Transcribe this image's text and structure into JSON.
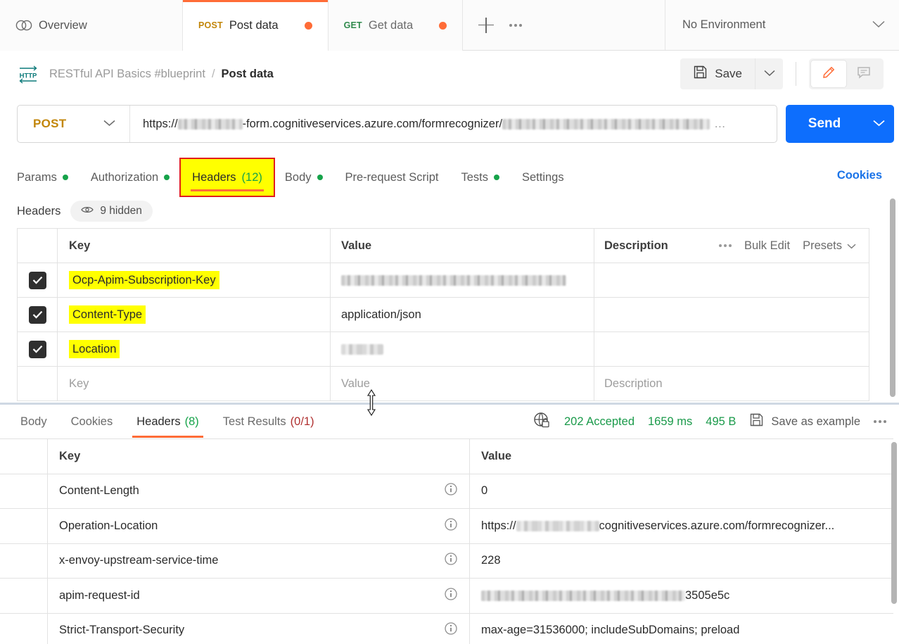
{
  "tabbar": {
    "overview_label": "Overview",
    "tabs": [
      {
        "method": "POST",
        "name": "Post data",
        "unsaved": true,
        "active": true
      },
      {
        "method": "GET",
        "name": "Get data",
        "unsaved": true,
        "active": false
      }
    ],
    "new_tab_label": "+",
    "more_label": "•••",
    "environment": "No Environment"
  },
  "breadcrumb": {
    "icon": "http-icon",
    "collection": "RESTful API Basics #blueprint",
    "separator": "/",
    "current": "Post data",
    "save_label": "Save",
    "save_caret": "chevron-down-icon",
    "edit_icon": "pencil-icon",
    "comment_icon": "comment-icon"
  },
  "url": {
    "method": "POST",
    "value_prefix": "https://",
    "value_mid": "-form.cognitiveservices.azure.com/formrecognizer/",
    "value_ellipsis": "…",
    "send_label": "Send"
  },
  "request_tabs": [
    {
      "label": "Params",
      "dot": true,
      "count": "",
      "active": false,
      "highlight": false
    },
    {
      "label": "Authorization",
      "dot": true,
      "count": "",
      "active": false,
      "highlight": false
    },
    {
      "label": "Headers",
      "dot": false,
      "count": "(12)",
      "active": true,
      "highlight": true
    },
    {
      "label": "Body",
      "dot": true,
      "count": "",
      "active": false,
      "highlight": false
    },
    {
      "label": "Pre-request Script",
      "dot": false,
      "count": "",
      "active": false,
      "highlight": false
    },
    {
      "label": "Tests",
      "dot": true,
      "count": "",
      "active": false,
      "highlight": false
    },
    {
      "label": "Settings",
      "dot": false,
      "count": "",
      "active": false,
      "highlight": false
    }
  ],
  "cookies_link": "Cookies",
  "headers_section": {
    "title": "Headers",
    "hidden_label": "9 hidden",
    "eye_icon": "eye-icon",
    "columns": {
      "key": "Key",
      "value": "Value",
      "description": "Description"
    },
    "toolbar": {
      "more": "•••",
      "bulk_edit": "Bulk Edit",
      "presets": "Presets"
    },
    "rows": [
      {
        "checked": true,
        "key": "Ocp-Apim-Subscription-Key",
        "key_highlighted": true,
        "value": "",
        "value_redacted": true,
        "description": ""
      },
      {
        "checked": true,
        "key": "Content-Type",
        "key_highlighted": true,
        "value": "application/json",
        "value_redacted": false,
        "description": ""
      },
      {
        "checked": true,
        "key": "Location",
        "key_highlighted": true,
        "value": "",
        "value_redacted": true,
        "description": ""
      }
    ],
    "placeholder_row": {
      "key": "Key",
      "value": "Value",
      "description": "Description"
    }
  },
  "response": {
    "tabs": [
      {
        "label": "Body",
        "count": "",
        "active": false
      },
      {
        "label": "Cookies",
        "count": "",
        "active": false
      },
      {
        "label": "Headers",
        "count": "(8)",
        "active": true
      },
      {
        "label": "Test Results",
        "count": "(0/1)",
        "active": false
      }
    ],
    "status": "202 Accepted",
    "time": "1659 ms",
    "size": "495 B",
    "lock_icon": "globe-lock-icon",
    "save_example_label": "Save as example",
    "more_label": "•••",
    "columns": {
      "key": "Key",
      "value": "Value"
    },
    "rows": [
      {
        "key": "Content-Length",
        "value": "0",
        "value_redacted": false
      },
      {
        "key": "Operation-Location",
        "value": "cognitiveservices.azure.com/formrecognizer...",
        "value_redacted": true,
        "value_prefix": "https://"
      },
      {
        "key": "x-envoy-upstream-service-time",
        "value": "228",
        "value_redacted": false
      },
      {
        "key": "apim-request-id",
        "value": "3505e5c",
        "value_redacted": true,
        "value_prefix": ""
      },
      {
        "key": "Strict-Transport-Security",
        "value": "max-age=31536000; includeSubDomains; preload",
        "value_redacted": false
      }
    ],
    "info_icon": "info-icon"
  },
  "colors": {
    "accent_orange": "#ff6c37",
    "send_blue": "#0d6efd",
    "link_blue": "#1a73e8",
    "green": "#16a34a",
    "highlight_yellow": "#ffff00",
    "annotation_red": "#e11d1d",
    "post_amber": "#c2860a"
  }
}
